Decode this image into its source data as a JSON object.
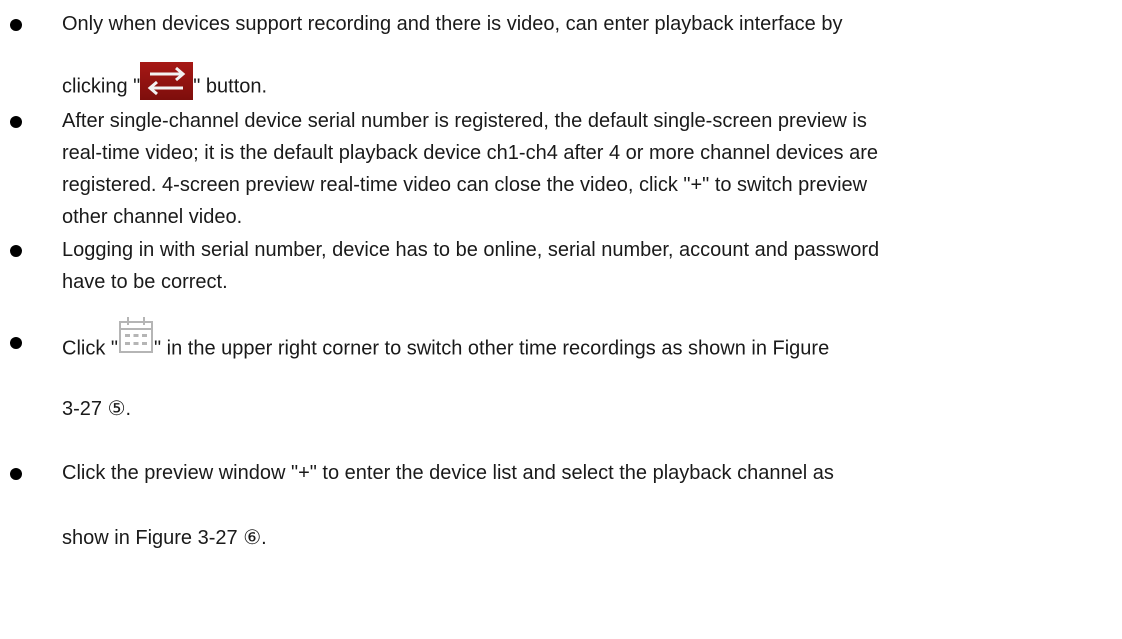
{
  "items": [
    {
      "line1": "Only when devices support recording and there is video, can enter playback interface by",
      "line2_before": "clicking \"",
      "line2_icon": "swap-arrows-icon",
      "line2_after": "\" button."
    },
    {
      "line1": "After single-channel device serial number is registered, the default single-screen preview is",
      "line2": "real-time video; it is the default playback device ch1-ch4 after 4 or more channel devices are",
      "line3": "registered. 4-screen preview real-time video can close the video, click \"+\" to switch preview",
      "line4": "other channel video."
    },
    {
      "line1": "Logging in with serial number, device has to be online, serial number, account and password",
      "line2": "have to be correct."
    },
    {
      "line1_before": "Click \"",
      "line1_icon": "calendar-icon",
      "line1_after": "\" in the upper right corner to switch other time recordings as shown in Figure",
      "line2": "3-27 ⑤."
    },
    {
      "line1": "Click the preview window \"+\" to enter the device list and select the playback channel as",
      "line2": "show in Figure 3-27 ⑥."
    }
  ],
  "colors": {
    "switch_button": "#8e1210",
    "calendar_icon": "#b5b5b5"
  }
}
